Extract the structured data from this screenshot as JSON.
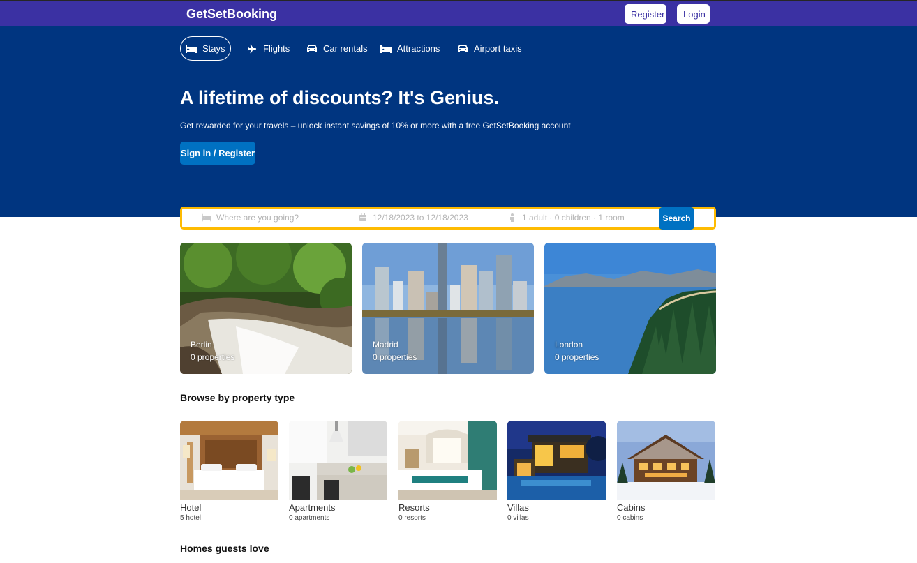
{
  "header": {
    "logo": "GetSetBooking",
    "register_label": "Register",
    "login_label": "Login"
  },
  "nav": {
    "items": [
      {
        "label": "Stays",
        "icon": "bed-icon",
        "active": true
      },
      {
        "label": "Flights",
        "icon": "plane-icon",
        "active": false
      },
      {
        "label": "Car rentals",
        "icon": "car-icon",
        "active": false
      },
      {
        "label": "Attractions",
        "icon": "bed-icon",
        "active": false
      },
      {
        "label": "Airport taxis",
        "icon": "taxi-icon",
        "active": false
      }
    ]
  },
  "hero": {
    "title": "A lifetime of discounts? It's Genius.",
    "subtitle": "Get rewarded for your travels – unlock instant savings of 10% or more with a free GetSetBooking account",
    "cta_label": "Sign in / Register"
  },
  "search": {
    "destination_placeholder": "Where are you going?",
    "dates": "12/18/2023 to 12/18/2023",
    "guests": "1 adult · 0 children · 1 room",
    "button_label": "Search"
  },
  "featured": [
    {
      "city": "Berlin",
      "properties": "0 properties"
    },
    {
      "city": "Madrid",
      "properties": "0 properties"
    },
    {
      "city": "London",
      "properties": "0 properties"
    }
  ],
  "property_types": {
    "title": "Browse by property type",
    "items": [
      {
        "name": "Hotel",
        "count": "5 hotel"
      },
      {
        "name": "Apartments",
        "count": "0 apartments"
      },
      {
        "name": "Resorts",
        "count": "0 resorts"
      },
      {
        "name": "Villas",
        "count": "0 villas"
      },
      {
        "name": "Cabins",
        "count": "0 cabins"
      }
    ]
  },
  "homes": {
    "title": "Homes guests love"
  },
  "colors": {
    "topbar": "#3b31a3",
    "hero": "#003580",
    "accent_button": "#0071c2",
    "search_border": "#febb02"
  }
}
